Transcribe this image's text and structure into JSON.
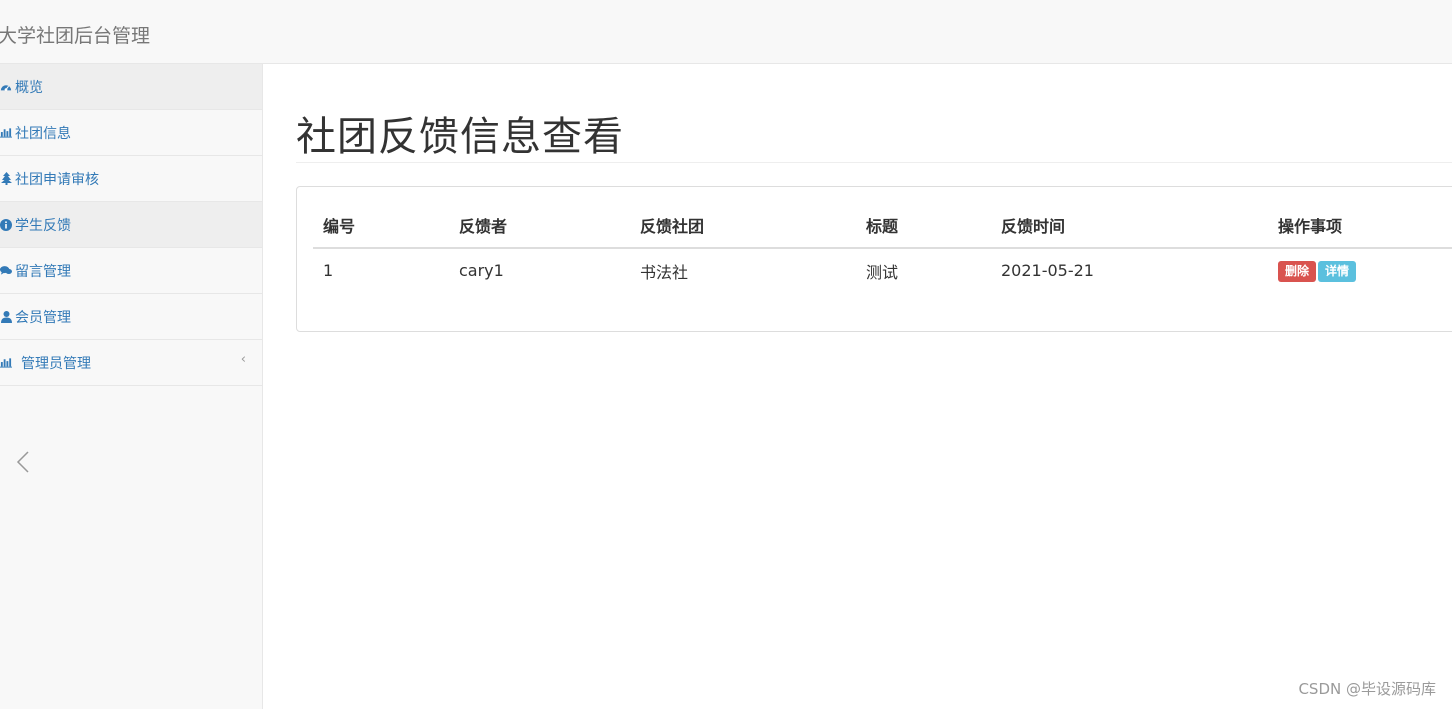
{
  "app": {
    "brand": "大学社团后台管理"
  },
  "sidebar": {
    "items": [
      {
        "label": "概览",
        "icon": "dashboard-icon"
      },
      {
        "label": "社团信息",
        "icon": "bar-chart-icon"
      },
      {
        "label": "社团申请审核",
        "icon": "tree-icon"
      },
      {
        "label": "学生反馈",
        "icon": "info-circle-icon"
      },
      {
        "label": "留言管理",
        "icon": "comments-icon"
      },
      {
        "label": "会员管理",
        "icon": "user-icon"
      },
      {
        "label": "管理员管理",
        "icon": "bar-chart-icon",
        "caret": "‹"
      }
    ]
  },
  "main": {
    "title": "社团反馈信息查看",
    "table": {
      "headers": [
        "编号",
        "反馈者",
        "反馈社团",
        "标题",
        "反馈时间",
        "操作事项"
      ],
      "rows": [
        {
          "id": "1",
          "user": "cary1",
          "club": "书法社",
          "title": "测试",
          "time": "2021-05-21"
        }
      ],
      "actions": {
        "delete": "删除",
        "detail": "详情"
      }
    }
  },
  "watermark": "CSDN @毕设源码库",
  "colors": {
    "link": "#337ab7",
    "danger": "#d9534f",
    "info": "#5bc0de",
    "navbar_bg": "#f8f8f8"
  }
}
